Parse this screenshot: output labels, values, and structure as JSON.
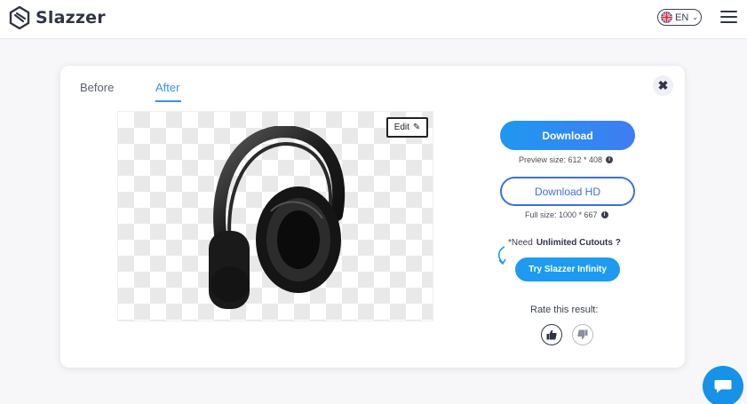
{
  "header": {
    "brand": "Slazzer",
    "language": "EN"
  },
  "tabs": [
    {
      "label": "Before",
      "active": false
    },
    {
      "label": "After",
      "active": true
    }
  ],
  "editor": {
    "edit_label": "Edit"
  },
  "actions": {
    "download_label": "Download",
    "preview_size_label": "Preview size: 612 * 408",
    "download_hd_label": "Download HD",
    "full_size_label": "Full size: 1000 * 667"
  },
  "upsell": {
    "need_prefix": "*Need",
    "need_highlight": "Unlimited Cutouts ?",
    "cta_label": "Try Slazzer Infinity"
  },
  "rating": {
    "label": "Rate this result:"
  },
  "colors": {
    "accent": "#3c8ee8",
    "download_gradient_start": "#1f98ee",
    "download_gradient_end": "#3f7cf2",
    "hd_border": "#3c6fe2",
    "infinity_bg": "#1e9bf0",
    "chat_bg": "#1792e6"
  },
  "icons": [
    "slazzer-logo-icon",
    "uk-flag-icon",
    "chevron-down-icon",
    "menu-icon",
    "close-icon",
    "pencil-icon",
    "info-icon",
    "curved-arrow-icon",
    "thumbs-up-icon",
    "thumbs-down-icon",
    "chat-icon"
  ]
}
